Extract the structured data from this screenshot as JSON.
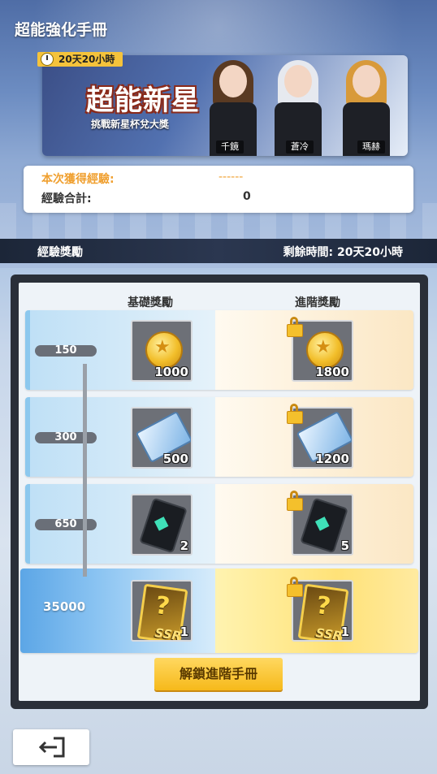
{
  "header": {
    "title": "超能強化手冊"
  },
  "banner": {
    "timer": "20天20小時",
    "title": "超能新星",
    "subtitle": "挑戰新星杯兌大獎",
    "characters": [
      "千鏡",
      "蒼冷",
      "瑪赫"
    ]
  },
  "exp": {
    "current_label": "本次獲得經驗:",
    "current_value": "------",
    "total_label": "經驗合計:",
    "total_value": "0"
  },
  "section": {
    "left": "經驗獎勵",
    "right": "剩餘時間: 20天20小時"
  },
  "rewards": {
    "basic_header": "基礎獎勵",
    "advanced_header": "進階獎勵",
    "rows": [
      {
        "level": "150",
        "basic_qty": "1000",
        "adv_qty": "1800",
        "item": "coin-icon"
      },
      {
        "level": "300",
        "basic_qty": "500",
        "adv_qty": "1200",
        "item": "ticket-icon"
      },
      {
        "level": "650",
        "basic_qty": "2",
        "adv_qty": "5",
        "item": "chip-icon"
      },
      {
        "level": "35000",
        "basic_qty": "1",
        "adv_qty": "1",
        "item": "ssr-card-icon",
        "ssr_label": "SSR",
        "ssr_mark": "?"
      }
    ]
  },
  "unlock_button": "解鎖進階手冊",
  "colors": {
    "accent": "#f6b91a",
    "exp_highlight": "#f0a030",
    "panel": "#2a2f38"
  }
}
